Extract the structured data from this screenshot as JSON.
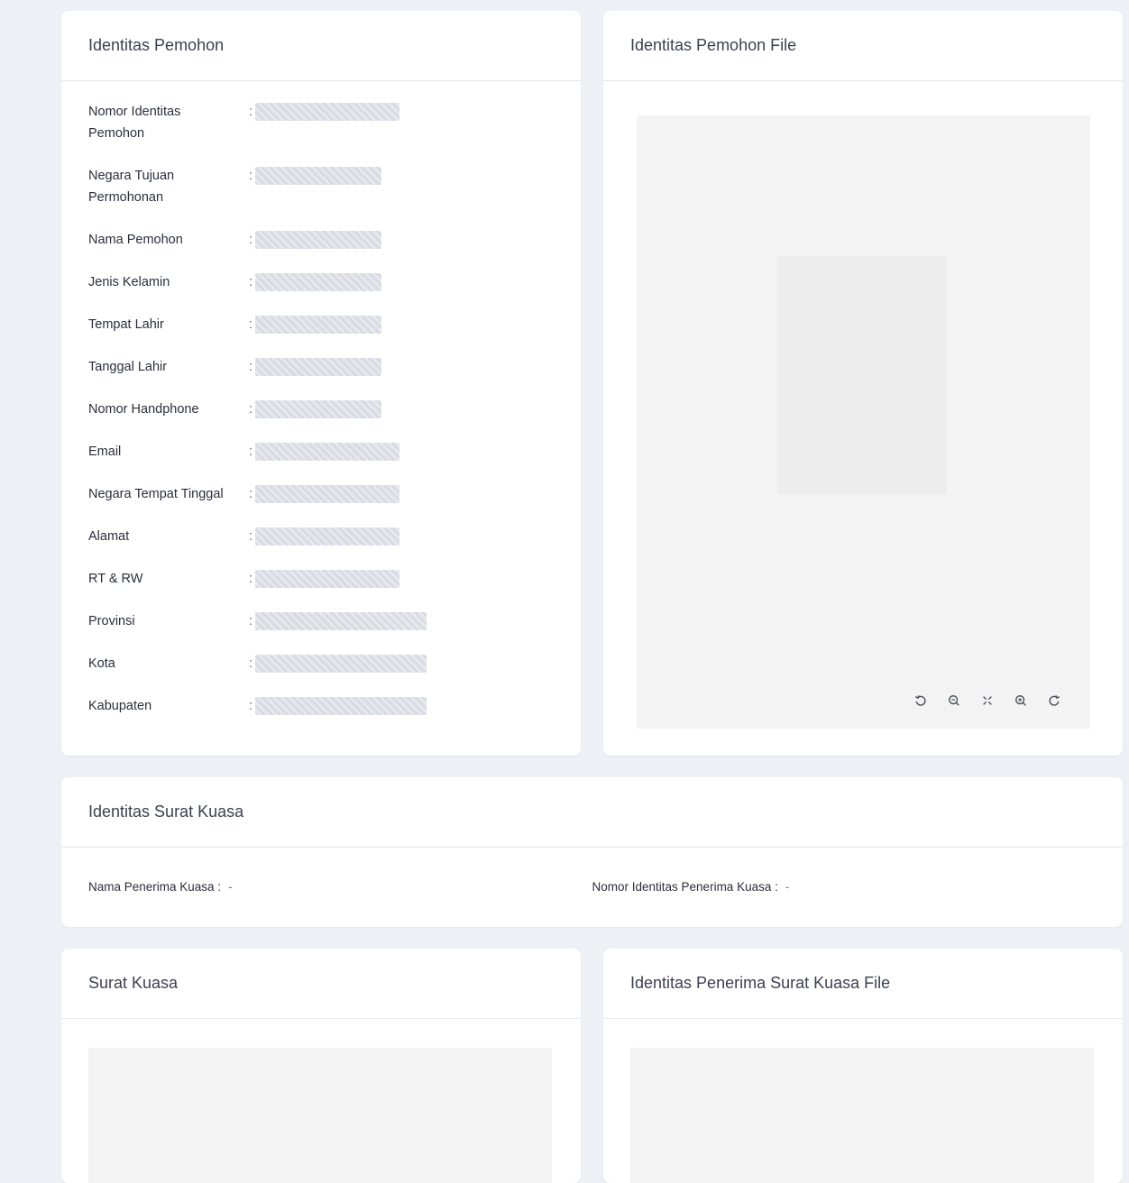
{
  "identitas_pemohon": {
    "title": "Identitas Pemohon",
    "fields": [
      {
        "label": "Nomor Identitas Pemohon",
        "colon": ":",
        "tall": true
      },
      {
        "label": "Negara Tujuan Permohonan",
        "colon": ":",
        "tall": true
      },
      {
        "label": "Nama Pemohon",
        "colon": ":"
      },
      {
        "label": "Jenis Kelamin",
        "colon": ":"
      },
      {
        "label": "Tempat Lahir",
        "colon": ":"
      },
      {
        "label": "Tanggal Lahir",
        "colon": ":"
      },
      {
        "label": "Nomor Handphone",
        "colon": ":"
      },
      {
        "label": "Email",
        "colon": ":"
      },
      {
        "label": "Negara Tempat Tinggal",
        "colon": ":"
      },
      {
        "label": "Alamat",
        "colon": ":"
      },
      {
        "label": "RT & RW",
        "colon": ":"
      },
      {
        "label": "Provinsi",
        "colon": ":"
      },
      {
        "label": "Kota",
        "colon": ":"
      },
      {
        "label": "Kabupaten",
        "colon": ":"
      }
    ]
  },
  "identitas_pemohon_file": {
    "title": "Identitas Pemohon File",
    "toolbar": [
      {
        "name": "rotate-left-icon"
      },
      {
        "name": "zoom-out-icon"
      },
      {
        "name": "fit-screen-icon"
      },
      {
        "name": "zoom-in-icon"
      },
      {
        "name": "rotate-right-icon"
      }
    ]
  },
  "identitas_surat_kuasa": {
    "title": "Identitas Surat Kuasa",
    "nama_label": "Nama Penerima Kuasa :",
    "nama_value": "-",
    "nomor_label": "Nomor Identitas Penerima Kuasa :",
    "nomor_value": "-"
  },
  "surat_kuasa": {
    "title": "Surat Kuasa"
  },
  "penerima_file": {
    "title": "Identitas Penerima Surat Kuasa File"
  },
  "colors": {
    "background": "#eef0f5",
    "card": "#ffffff",
    "viewer": "#f3f3f3"
  }
}
